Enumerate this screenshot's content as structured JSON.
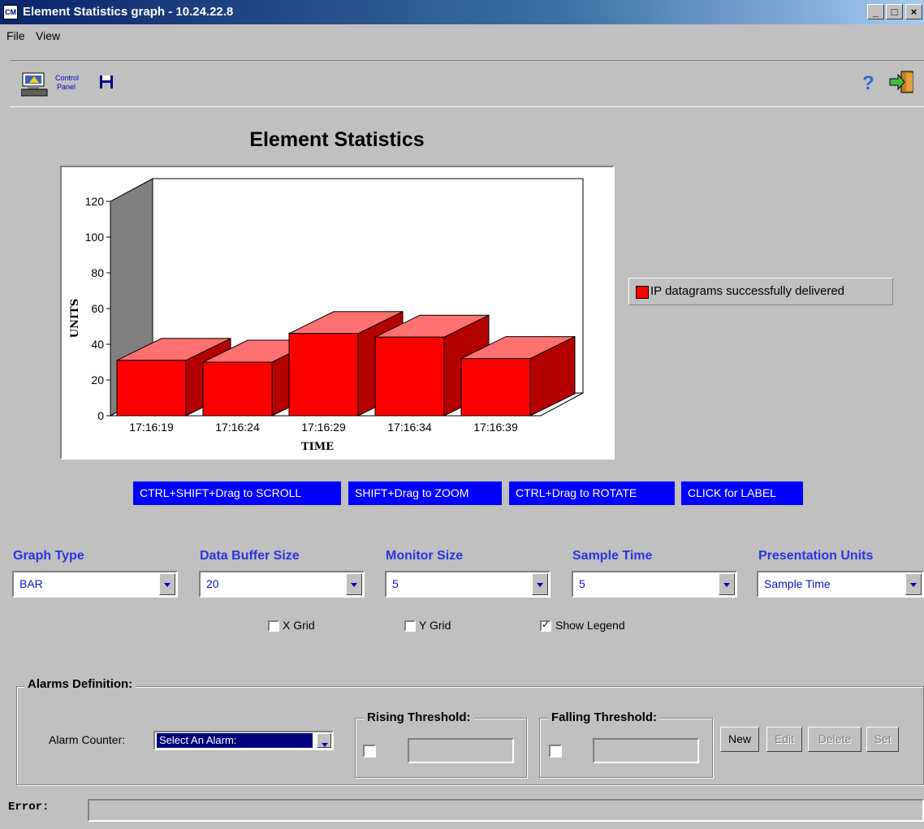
{
  "window": {
    "title": "Element Statistics graph - 10.24.22.8",
    "icon_text": "CM",
    "controls": [
      "minimize-icon",
      "maximize-icon",
      "close-icon"
    ]
  },
  "menu": {
    "items": [
      "File",
      "View"
    ]
  },
  "toolbar": {
    "control_panel_label": "Control Panel",
    "icons": [
      "control-panel-icon",
      "save-icon",
      "help-icon",
      "exit-icon"
    ]
  },
  "chart": {
    "heading": "Element Statistics",
    "legend": "IP datagrams successfully delivered",
    "bar_color": "#ff0000"
  },
  "chart_data": {
    "type": "bar",
    "title": "Element Statistics",
    "categories": [
      "17:16:19",
      "17:16:24",
      "17:16:29",
      "17:16:34",
      "17:16:39"
    ],
    "series": [
      {
        "name": "IP datagrams successfully delivered",
        "values": [
          31,
          30,
          46,
          44,
          32
        ]
      }
    ],
    "xlabel": "TIME",
    "ylabel": "UNITS",
    "ylim": [
      0,
      120
    ],
    "yticks": [
      0,
      20,
      40,
      60,
      80,
      100,
      120
    ],
    "grid": false,
    "legend_position": "right",
    "style": "3d"
  },
  "hints": [
    "CTRL+SHIFT+Drag to SCROLL",
    "SHIFT+Drag to ZOOM",
    "CTRL+Drag to ROTATE",
    "CLICK for LABEL"
  ],
  "controls": {
    "graph_type": {
      "label": "Graph Type",
      "value": "BAR"
    },
    "data_buffer_size": {
      "label": "Data Buffer Size",
      "value": "20"
    },
    "monitor_size": {
      "label": "Monitor Size",
      "value": "5"
    },
    "sample_time": {
      "label": "Sample Time",
      "value": "5"
    },
    "presentation_units": {
      "label": "Presentation Units",
      "value": "Sample Time"
    },
    "x_grid": {
      "label": "X Grid",
      "checked": false
    },
    "y_grid": {
      "label": "Y Grid",
      "checked": false
    },
    "show_legend": {
      "label": "Show Legend",
      "checked": true
    }
  },
  "alarms": {
    "title": "Alarms Definition:",
    "counter_label": "Alarm Counter:",
    "counter_value": "Select An Alarm:",
    "rising_title": "Rising Threshold:",
    "falling_title": "Falling Threshold:",
    "buttons": {
      "new": "New",
      "edit": "Edit",
      "delete": "Delete",
      "set": "Set"
    }
  },
  "status": {
    "error_label": "Error:",
    "error_value": ""
  }
}
